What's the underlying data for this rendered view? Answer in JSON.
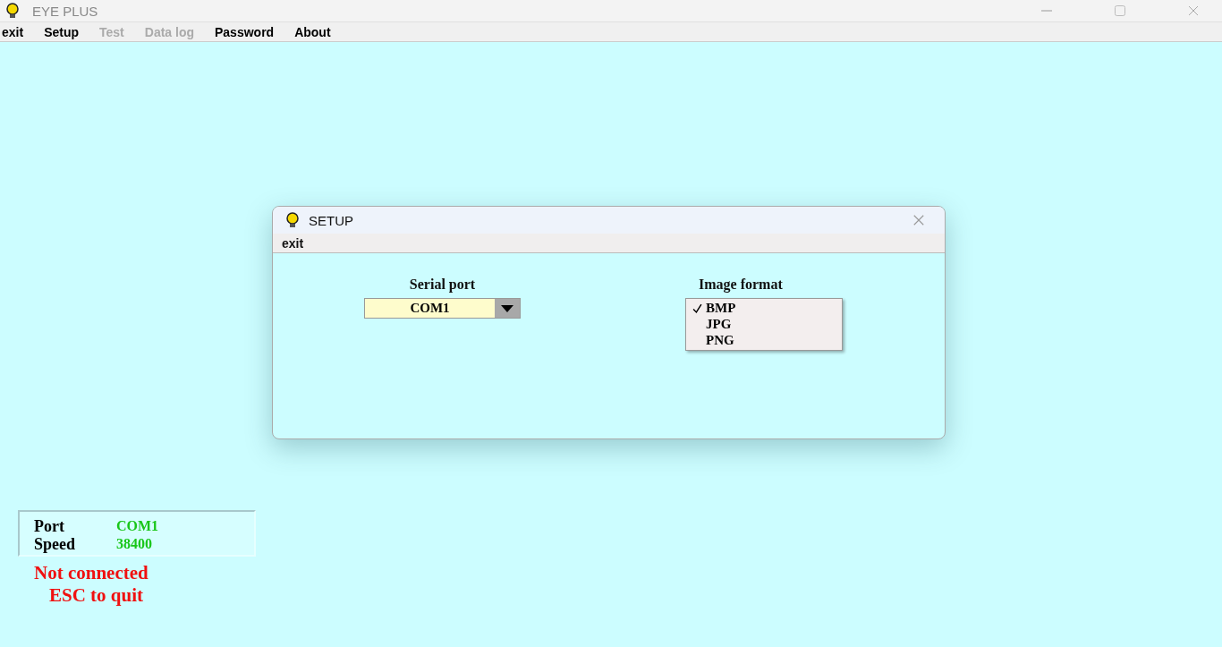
{
  "window": {
    "title": "EYE PLUS"
  },
  "menu": [
    {
      "label": "exit",
      "disabled": false
    },
    {
      "label": "Setup",
      "disabled": false
    },
    {
      "label": "Test",
      "disabled": true
    },
    {
      "label": "Data log",
      "disabled": true
    },
    {
      "label": "Password",
      "disabled": false
    },
    {
      "label": "About",
      "disabled": false
    }
  ],
  "dialog": {
    "title": "SETUP",
    "menu": [
      "exit"
    ],
    "serial_port": {
      "label": "Serial port",
      "value": "COM1"
    },
    "image_format": {
      "label": "Image format",
      "options": [
        {
          "label": "BMP",
          "selected": true
        },
        {
          "label": "JPG",
          "selected": false
        },
        {
          "label": "PNG",
          "selected": false
        }
      ]
    }
  },
  "status": {
    "port_label": "Port",
    "port": "COM1",
    "speed_label": "Speed",
    "speed": "38400",
    "connection": "Not connected",
    "hint": "ESC to quit"
  }
}
